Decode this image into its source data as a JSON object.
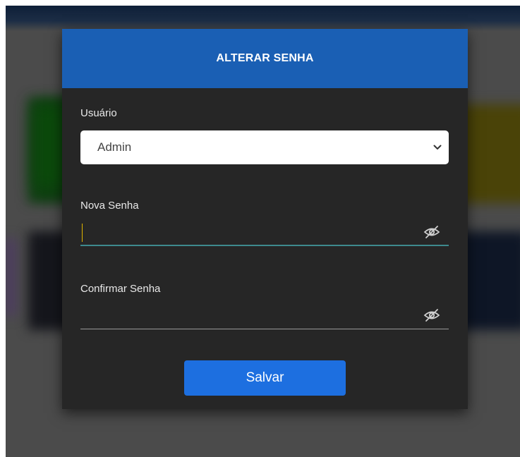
{
  "dialog": {
    "title": "ALTERAR SENHA"
  },
  "form": {
    "user_label": "Usuário",
    "user_value": "Admin",
    "new_password_label": "Nova Senha",
    "new_password_value": "",
    "confirm_password_label": "Confirmar Senha",
    "confirm_password_value": "",
    "save_label": "Salvar"
  },
  "icons": {
    "select_arrow": "chevron-down-icon",
    "password_toggle": "eye-slash-icon"
  },
  "colors": {
    "header": "#1a5fb4",
    "dialog_bg": "#262626",
    "button": "#1d6fe0",
    "active_underline": "#3e8a8e"
  }
}
